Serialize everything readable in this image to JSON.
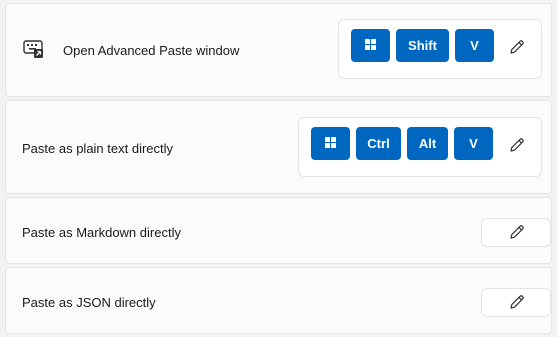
{
  "rows": [
    {
      "label": "Open Advanced Paste window",
      "keys": [
        "win",
        "Shift",
        "V"
      ]
    },
    {
      "label": "Paste as plain text directly",
      "keys": [
        "win",
        "Ctrl",
        "Alt",
        "V"
      ]
    },
    {
      "label": "Paste as Markdown directly",
      "keys": []
    },
    {
      "label": "Paste as JSON directly",
      "keys": []
    }
  ],
  "icons": {
    "app": "keyboard-paste-icon",
    "windows_key": "windows-logo-icon",
    "edit": "pencil-icon"
  },
  "colors": {
    "key_background": "#0067c0",
    "key_text": "#ffffff",
    "card_background": "#fbfbfb",
    "page_background": "#f3f3f3"
  }
}
